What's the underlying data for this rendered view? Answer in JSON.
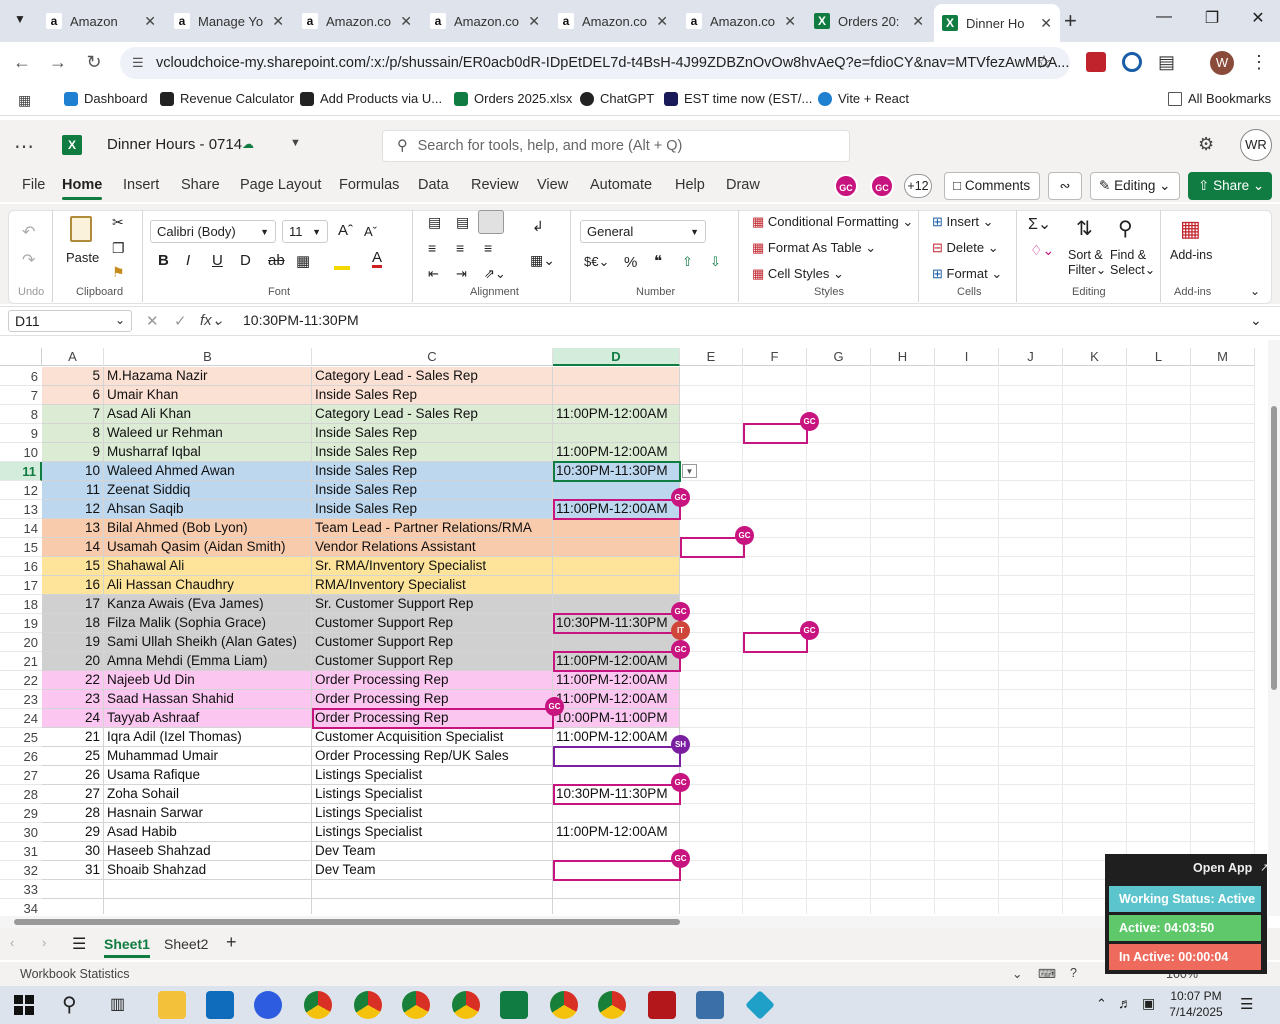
{
  "browser": {
    "tabs": [
      {
        "label": "Amazon",
        "icon": "amazon-icon"
      },
      {
        "label": "Manage Yo",
        "icon": "amazon-icon"
      },
      {
        "label": "Amazon.co",
        "icon": "amazon-icon"
      },
      {
        "label": "Amazon.co",
        "icon": "amazon-icon"
      },
      {
        "label": "Amazon.co",
        "icon": "amazon-icon"
      },
      {
        "label": "Amazon.co",
        "icon": "amazon-icon"
      },
      {
        "label": "Orders 20:",
        "icon": "excel-icon"
      },
      {
        "label": "Dinner Ho",
        "icon": "excel-icon",
        "active": true
      }
    ],
    "url": "vcloudchoice-my.sharepoint.com/:x:/p/shussain/ER0acb0dR-IDpEtDEL7d-t4BsH-4J99ZDBZnOvOw8hvAeQ?e=fdioCY&nav=MTVfezAwMDA...",
    "profile_initial": "W",
    "bookmarks": [
      "Dashboard",
      "Revenue Calculator",
      "Add Products via U...",
      "Orders 2025.xlsx",
      "ChatGPT",
      "EST time now (EST/...",
      "Vite + React"
    ],
    "all_bookmarks": "All Bookmarks"
  },
  "excel": {
    "doc_title": "Dinner Hours - 0714",
    "search_placeholder": "Search for tools, help, and more (Alt + Q)",
    "user_initials": "WR",
    "menus": [
      "File",
      "Home",
      "Insert",
      "Share",
      "Page Layout",
      "Formulas",
      "Data",
      "Review",
      "View",
      "Automate",
      "Help",
      "Draw"
    ],
    "collab": {
      "a": "GC",
      "b": "GC",
      "more": "+12"
    },
    "comments": "Comments",
    "editing": "Editing",
    "share": "Share",
    "ribbon": {
      "undo": "Undo",
      "clipboard": "Clipboard",
      "paste": "Paste",
      "font_name": "Calibri (Body)",
      "font_size": "11",
      "font": "Font",
      "alignment": "Alignment",
      "number_format": "General",
      "number": "Number",
      "cond_format": "Conditional Formatting",
      "format_table": "Format As Table",
      "cell_styles": "Cell Styles",
      "styles": "Styles",
      "insert": "Insert",
      "delete": "Delete",
      "format": "Format",
      "cells": "Cells",
      "sort1": "Sort &",
      "sort2": "Filter",
      "find1": "Find &",
      "find2": "Select",
      "editing": "Editing",
      "addins": "Add-ins",
      "addins_group": "Add-ins"
    },
    "name_box": "D11",
    "formula": "10:30PM-11:30PM",
    "columns": [
      "A",
      "B",
      "C",
      "D",
      "E",
      "F",
      "G",
      "H",
      "I",
      "J",
      "K",
      "L",
      "M"
    ],
    "rows": [
      {
        "r": "6",
        "a": "5",
        "b": "M.Hazama Nazir",
        "c": "Category Lead - Sales Rep",
        "d": "",
        "bg": "#fbe0d4"
      },
      {
        "r": "7",
        "a": "6",
        "b": "Umair Khan",
        "c": "Inside Sales Rep",
        "d": "",
        "bg": "#fbe0d4"
      },
      {
        "r": "8",
        "a": "7",
        "b": "Asad Ali Khan",
        "c": "Category Lead - Sales Rep",
        "d": "11:00PM-12:00AM",
        "bg": "#dcecd4"
      },
      {
        "r": "9",
        "a": "8",
        "b": "Waleed ur Rehman",
        "c": "Inside Sales Rep",
        "d": "",
        "bg": "#dcecd4"
      },
      {
        "r": "10",
        "a": "9",
        "b": "Musharraf Iqbal",
        "c": "Inside Sales Rep",
        "d": "11:00PM-12:00AM",
        "bg": "#dcecd4"
      },
      {
        "r": "11",
        "a": "10",
        "b": "Waleed Ahmed Awan",
        "c": "Inside Sales Rep",
        "d": "10:30PM-11:30PM",
        "bg": "#bcd7ee"
      },
      {
        "r": "12",
        "a": "11",
        "b": "Zeenat Siddiq",
        "c": "Inside Sales Rep",
        "d": "",
        "bg": "#bcd7ee"
      },
      {
        "r": "13",
        "a": "12",
        "b": "Ahsan Saqib",
        "c": "Inside Sales Rep",
        "d": "11:00PM-12:00AM",
        "bg": "#bcd7ee"
      },
      {
        "r": "14",
        "a": "13",
        "b": "Bilal Ahmed (Bob Lyon)",
        "c": "Team Lead - Partner Relations/RMA",
        "d": "",
        "bg": "#f8cbac"
      },
      {
        "r": "15",
        "a": "14",
        "b": "Usamah Qasim (Aidan Smith)",
        "c": "Vendor Relations Assistant",
        "d": "",
        "bg": "#f8cbac"
      },
      {
        "r": "16",
        "a": "15",
        "b": "Shahawal Ali",
        "c": "Sr. RMA/Inventory Specialist",
        "d": "",
        "bg": "#fde49a"
      },
      {
        "r": "17",
        "a": "16",
        "b": "Ali Hassan Chaudhry",
        "c": "RMA/Inventory Specialist",
        "d": "",
        "bg": "#fde49a"
      },
      {
        "r": "18",
        "a": "17",
        "b": "Kanza Awais (Eva James)",
        "c": "Sr. Customer Support Rep",
        "d": "",
        "bg": "#d0d0d0"
      },
      {
        "r": "19",
        "a": "18",
        "b": "Filza Malik (Sophia Grace)",
        "c": "Customer Support Rep",
        "d": "10:30PM-11:30PM",
        "bg": "#d0d0d0"
      },
      {
        "r": "20",
        "a": "19",
        "b": "Sami Ullah Sheikh (Alan Gates)",
        "c": "Customer Support Rep",
        "d": "",
        "bg": "#d0d0d0"
      },
      {
        "r": "21",
        "a": "20",
        "b": "Amna Mehdi (Emma Liam)",
        "c": "Customer Support Rep",
        "d": "11:00PM-12:00AM",
        "bg": "#d0d0d0"
      },
      {
        "r": "22",
        "a": "22",
        "b": "Najeeb Ud Din",
        "c": "Order Processing Rep",
        "d": "11:00PM-12:00AM",
        "bg": "#fbc6f0"
      },
      {
        "r": "23",
        "a": "23",
        "b": "Saad Hassan Shahid",
        "c": "Order Processing Rep",
        "d": "11:00PM-12:00AM",
        "bg": "#fbc6f0"
      },
      {
        "r": "24",
        "a": "24",
        "b": "Tayyab Ashraaf",
        "c": "Order Processing Rep",
        "d": "10:00PM-11:00PM",
        "bg": "#fbc6f0"
      },
      {
        "r": "25",
        "a": "21",
        "b": "Iqra Adil (Izel Thomas)",
        "c": "Customer Acquisition Specialist",
        "d": "11:00PM-12:00AM",
        "bg": "#ffffff"
      },
      {
        "r": "26",
        "a": "25",
        "b": "Muhammad Umair",
        "c": "Order Processing Rep/UK Sales",
        "d": "",
        "bg": "#ffffff"
      },
      {
        "r": "27",
        "a": "26",
        "b": "Usama Rafique",
        "c": "Listings Specialist",
        "d": "",
        "bg": "#ffffff"
      },
      {
        "r": "28",
        "a": "27",
        "b": "Zoha Sohail",
        "c": "Listings Specialist",
        "d": "10:30PM-11:30PM",
        "bg": "#ffffff"
      },
      {
        "r": "29",
        "a": "28",
        "b": "Hasnain Sarwar",
        "c": "Listings Specialist",
        "d": "",
        "bg": "#ffffff"
      },
      {
        "r": "30",
        "a": "29",
        "b": "Asad Habib",
        "c": "Listings Specialist",
        "d": "11:00PM-12:00AM",
        "bg": "#ffffff"
      },
      {
        "r": "31",
        "a": "30",
        "b": "Haseeb Shahzad",
        "c": "Dev Team",
        "d": "",
        "bg": "#ffffff"
      },
      {
        "r": "32",
        "a": "31",
        "b": "Shoaib Shahzad",
        "c": "Dev Team",
        "d": "",
        "bg": "#ffffff"
      },
      {
        "r": "33",
        "a": "",
        "b": "",
        "c": "",
        "d": "",
        "bg": "#ffffff"
      },
      {
        "r": "34",
        "a": "",
        "b": "",
        "c": "",
        "d": "",
        "bg": "#ffffff"
      }
    ],
    "badges": {
      "gc": "GC",
      "it": "IT",
      "sh": "SH"
    },
    "sheets": [
      "Sheet1",
      "Sheet2"
    ],
    "status_left": "Workbook Statistics",
    "zoom": "100%"
  },
  "widget": {
    "open_app": "Open App",
    "working": "Working Status: Active",
    "active": "Active: 04:03:50",
    "inactive": "In Active: 00:00:04"
  },
  "taskbar": {
    "time": "10:07 PM",
    "date": "7/14/2025"
  }
}
